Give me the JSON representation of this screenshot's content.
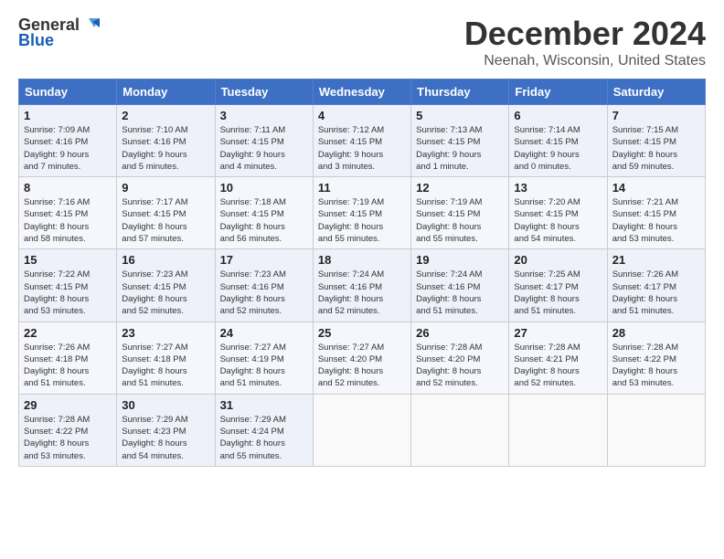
{
  "logo": {
    "line1": "General",
    "line2": "Blue"
  },
  "title": "December 2024",
  "subtitle": "Neenah, Wisconsin, United States",
  "weekdays": [
    "Sunday",
    "Monday",
    "Tuesday",
    "Wednesday",
    "Thursday",
    "Friday",
    "Saturday"
  ],
  "weeks": [
    [
      {
        "day": "1",
        "info": "Sunrise: 7:09 AM\nSunset: 4:16 PM\nDaylight: 9 hours\nand 7 minutes."
      },
      {
        "day": "2",
        "info": "Sunrise: 7:10 AM\nSunset: 4:16 PM\nDaylight: 9 hours\nand 5 minutes."
      },
      {
        "day": "3",
        "info": "Sunrise: 7:11 AM\nSunset: 4:15 PM\nDaylight: 9 hours\nand 4 minutes."
      },
      {
        "day": "4",
        "info": "Sunrise: 7:12 AM\nSunset: 4:15 PM\nDaylight: 9 hours\nand 3 minutes."
      },
      {
        "day": "5",
        "info": "Sunrise: 7:13 AM\nSunset: 4:15 PM\nDaylight: 9 hours\nand 1 minute."
      },
      {
        "day": "6",
        "info": "Sunrise: 7:14 AM\nSunset: 4:15 PM\nDaylight: 9 hours\nand 0 minutes."
      },
      {
        "day": "7",
        "info": "Sunrise: 7:15 AM\nSunset: 4:15 PM\nDaylight: 8 hours\nand 59 minutes."
      }
    ],
    [
      {
        "day": "8",
        "info": "Sunrise: 7:16 AM\nSunset: 4:15 PM\nDaylight: 8 hours\nand 58 minutes."
      },
      {
        "day": "9",
        "info": "Sunrise: 7:17 AM\nSunset: 4:15 PM\nDaylight: 8 hours\nand 57 minutes."
      },
      {
        "day": "10",
        "info": "Sunrise: 7:18 AM\nSunset: 4:15 PM\nDaylight: 8 hours\nand 56 minutes."
      },
      {
        "day": "11",
        "info": "Sunrise: 7:19 AM\nSunset: 4:15 PM\nDaylight: 8 hours\nand 55 minutes."
      },
      {
        "day": "12",
        "info": "Sunrise: 7:19 AM\nSunset: 4:15 PM\nDaylight: 8 hours\nand 55 minutes."
      },
      {
        "day": "13",
        "info": "Sunrise: 7:20 AM\nSunset: 4:15 PM\nDaylight: 8 hours\nand 54 minutes."
      },
      {
        "day": "14",
        "info": "Sunrise: 7:21 AM\nSunset: 4:15 PM\nDaylight: 8 hours\nand 53 minutes."
      }
    ],
    [
      {
        "day": "15",
        "info": "Sunrise: 7:22 AM\nSunset: 4:15 PM\nDaylight: 8 hours\nand 53 minutes."
      },
      {
        "day": "16",
        "info": "Sunrise: 7:23 AM\nSunset: 4:15 PM\nDaylight: 8 hours\nand 52 minutes."
      },
      {
        "day": "17",
        "info": "Sunrise: 7:23 AM\nSunset: 4:16 PM\nDaylight: 8 hours\nand 52 minutes."
      },
      {
        "day": "18",
        "info": "Sunrise: 7:24 AM\nSunset: 4:16 PM\nDaylight: 8 hours\nand 52 minutes."
      },
      {
        "day": "19",
        "info": "Sunrise: 7:24 AM\nSunset: 4:16 PM\nDaylight: 8 hours\nand 51 minutes."
      },
      {
        "day": "20",
        "info": "Sunrise: 7:25 AM\nSunset: 4:17 PM\nDaylight: 8 hours\nand 51 minutes."
      },
      {
        "day": "21",
        "info": "Sunrise: 7:26 AM\nSunset: 4:17 PM\nDaylight: 8 hours\nand 51 minutes."
      }
    ],
    [
      {
        "day": "22",
        "info": "Sunrise: 7:26 AM\nSunset: 4:18 PM\nDaylight: 8 hours\nand 51 minutes."
      },
      {
        "day": "23",
        "info": "Sunrise: 7:27 AM\nSunset: 4:18 PM\nDaylight: 8 hours\nand 51 minutes."
      },
      {
        "day": "24",
        "info": "Sunrise: 7:27 AM\nSunset: 4:19 PM\nDaylight: 8 hours\nand 51 minutes."
      },
      {
        "day": "25",
        "info": "Sunrise: 7:27 AM\nSunset: 4:20 PM\nDaylight: 8 hours\nand 52 minutes."
      },
      {
        "day": "26",
        "info": "Sunrise: 7:28 AM\nSunset: 4:20 PM\nDaylight: 8 hours\nand 52 minutes."
      },
      {
        "day": "27",
        "info": "Sunrise: 7:28 AM\nSunset: 4:21 PM\nDaylight: 8 hours\nand 52 minutes."
      },
      {
        "day": "28",
        "info": "Sunrise: 7:28 AM\nSunset: 4:22 PM\nDaylight: 8 hours\nand 53 minutes."
      }
    ],
    [
      {
        "day": "29",
        "info": "Sunrise: 7:28 AM\nSunset: 4:22 PM\nDaylight: 8 hours\nand 53 minutes."
      },
      {
        "day": "30",
        "info": "Sunrise: 7:29 AM\nSunset: 4:23 PM\nDaylight: 8 hours\nand 54 minutes."
      },
      {
        "day": "31",
        "info": "Sunrise: 7:29 AM\nSunset: 4:24 PM\nDaylight: 8 hours\nand 55 minutes."
      },
      null,
      null,
      null,
      null
    ]
  ]
}
